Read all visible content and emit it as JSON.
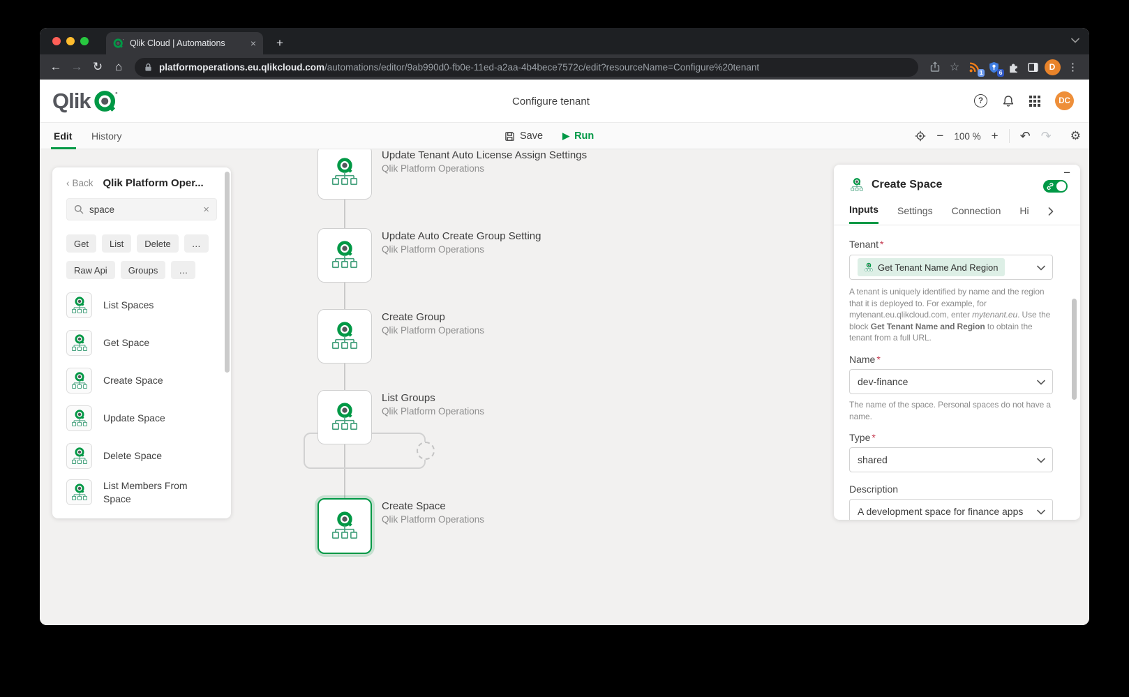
{
  "browser": {
    "tab": {
      "title": "Qlik Cloud | Automations",
      "close": "×",
      "new_tab": "+"
    },
    "address": {
      "domain": "platformoperations.eu.qlikcloud.com",
      "path": "/automations/editor/9ab990d0-fb0e-11ed-a2aa-4b4bece7572c/edit?resourceName=Configure%20tenant"
    },
    "nav": {
      "back": "←",
      "forward": "→",
      "reload": "↻",
      "home": "⌂"
    },
    "extensions": {
      "rss_badge": "1",
      "shield_badge": "6"
    },
    "profile_initial": "D",
    "menu_glyph": "⋮",
    "star_glyph": "☆"
  },
  "app": {
    "logo_text": "Qlik",
    "page_title": "Configure tenant",
    "avatar_initials": "DC",
    "help_glyph": "?"
  },
  "ribbon": {
    "tabs": {
      "edit": "Edit",
      "history": "History"
    },
    "save_label": "Save",
    "run_label": "Run",
    "play_glyph": "▶",
    "zoom_out": "−",
    "zoom_level": "100 %",
    "zoom_in": "+",
    "undo_glyph": "↶",
    "redo_glyph": "↷",
    "gear_glyph": "⚙"
  },
  "sidebar": {
    "back_label": "Back",
    "back_chevron": "‹",
    "title": "Qlik Platform Oper...",
    "search_value": "space",
    "clear_glyph": "×",
    "filters_row1": [
      "Get",
      "List",
      "Delete",
      "…"
    ],
    "filters_row2": [
      "Raw Api",
      "Groups",
      "…"
    ],
    "items": [
      {
        "label": "List Spaces"
      },
      {
        "label": "Get Space"
      },
      {
        "label": "Create Space"
      },
      {
        "label": "Update Space"
      },
      {
        "label": "Delete Space"
      },
      {
        "label": "List Members From Space"
      }
    ]
  },
  "canvas": {
    "blocks": [
      {
        "title": "Update Tenant Auto License Assign Settings",
        "subtitle": "Qlik Platform Operations"
      },
      {
        "title": "Update Auto Create Group Setting",
        "subtitle": "Qlik Platform Operations"
      },
      {
        "title": "Create Group",
        "subtitle": "Qlik Platform Operations"
      },
      {
        "title": "List Groups",
        "subtitle": "Qlik Platform Operations"
      },
      {
        "title": "Create Space",
        "subtitle": "Qlik Platform Operations"
      }
    ]
  },
  "inspector": {
    "collapse_glyph": "−",
    "title": "Create Space",
    "tabs": [
      "Inputs",
      "Settings",
      "Connection",
      "Hi"
    ],
    "required_mark": "*",
    "tenant": {
      "label": "Tenant",
      "value": "Get Tenant Name And Region",
      "help1": "A tenant is uniquely identified by name and the region that it is deployed to. For example, for mytenant.eu.qlikcloud.com, enter ",
      "help_italic": "mytenant.eu",
      "help2": ". Use the block ",
      "help_bold": "Get Tenant Name and Region",
      "help3": " to obtain the tenant from a full URL."
    },
    "name": {
      "label": "Name",
      "value": "dev-finance",
      "help": "The name of the space. Personal spaces do not have a name."
    },
    "type": {
      "label": "Type",
      "value": "shared"
    },
    "description": {
      "label": "Description",
      "value": "A development space for finance apps"
    }
  },
  "icons": [
    "qlik-logo",
    "qlik-block",
    "search",
    "close",
    "chevron-down",
    "chevron-right",
    "floppy",
    "play",
    "crosshair",
    "undo",
    "redo",
    "gear",
    "lock",
    "share",
    "star",
    "rss",
    "shield",
    "puzzle",
    "side-panel",
    "kebab",
    "help",
    "bell",
    "waffle",
    "link-toggle",
    "minus-collapse"
  ],
  "colors": {
    "accent_green": "#009845",
    "selected_halo": "rgba(0,152,69,0.18)",
    "chip_green_bg": "#ddefe6",
    "avatar_orange": "#ee8f3a",
    "profile_orange": "#e8832a",
    "required_red": "#c4374d"
  }
}
